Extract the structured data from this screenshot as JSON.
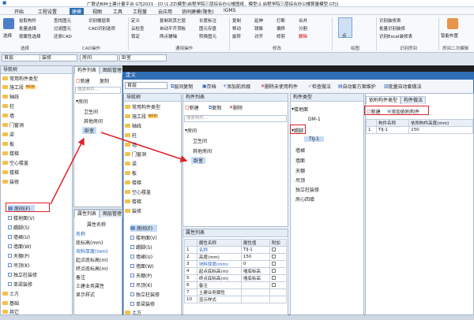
{
  "title": {
    "app": "广联达BIM土建计量平台 GTJ2021 - [D:\\1.ZZ\\模型\\启程学院三层综合办公楼图纸、模型\\1.启程学院三层综合办公楼算量模型.GTJ]",
    "module": "IGMS"
  },
  "menu": [
    "开始",
    "工程设置",
    "建模",
    "视图",
    "工具",
    "工程量",
    "云应用",
    "协同建模(限免)"
  ],
  "ribbon": {
    "select": "选择",
    "pick": "拾取构件",
    "batch": "批量选择",
    "byattr": "按属性选择",
    "findimg": "查找图元",
    "filter": "过滤图元",
    "cad_recog": "识别楼层表",
    "cad_opts": "CAD识别选项",
    "cad_restore": "还原CAD",
    "define": "定义",
    "cloud_check": "云检查",
    "lock": "锁定",
    "copy_to": "复制到其它层",
    "auto_floor": "自动平齐顶板",
    "elem_save": "图元存盘",
    "conv_elem": "转换图元",
    "two_point": "两点辅轴",
    "len_mark": "长度标注",
    "copy": "复制",
    "move": "移动",
    "rotate": "旋转",
    "mirror": "镜像",
    "align": "对齐",
    "extend": "延伸",
    "trim": "修剪",
    "offset": "偏移",
    "break": "打断",
    "merge": "合并",
    "split": "分割",
    "delete": "删除",
    "point": "点",
    "excel_decor": "识别Excel装修表",
    "recog_decor": "识别装修表",
    "batch_recog": "批量识别装修",
    "smart_layout": "智能布置",
    "groups": [
      "选择",
      "CAD操作",
      "通用操作",
      "修改",
      "绘图",
      "识别房间",
      "房间二次编辑"
    ]
  },
  "toolbar_selects": [
    "首层",
    "装修",
    "房间",
    "卧室"
  ],
  "nav": {
    "header": "导航树",
    "items": [
      {
        "label": "常用构件类型",
        "tag": ""
      },
      {
        "label": "施工段",
        "tag": "NEW"
      },
      {
        "label": "轴线",
        "tag": ""
      },
      {
        "label": "柱",
        "tag": ""
      },
      {
        "label": "墙",
        "tag": ""
      },
      {
        "label": "门窗洞",
        "tag": ""
      },
      {
        "label": "梁",
        "tag": ""
      },
      {
        "label": "板",
        "tag": ""
      },
      {
        "label": "楼梯",
        "tag": ""
      },
      {
        "label": "空心楼盖",
        "tag": ""
      },
      {
        "label": "楼梯",
        "tag": ""
      },
      {
        "label": "装修",
        "tag": ""
      }
    ],
    "sub": [
      "房间(F)",
      "楼地面(V)",
      "踢脚(S)",
      "墙裙(U)",
      "墙面(W)",
      "天棚(P)",
      "吊顶(K)",
      "独立柱装修",
      "单梁装修"
    ],
    "tail": [
      "土方",
      "基础",
      "其它",
      "自定义"
    ]
  },
  "left_list": {
    "tabs": [
      "构件列表",
      "图纸管理"
    ],
    "new": "新建",
    "copy": "复制",
    "search": "搜索构件...",
    "root": "房间",
    "items": [
      "卫生间",
      "其他房间",
      "卧室"
    ]
  },
  "left_attr": {
    "tabs": [
      "属性列表",
      "图层管理"
    ],
    "header": "属性名称",
    "rows": [
      "名称",
      "底标高(mm)",
      "块料厚度(mm)",
      "起点底标高(m)",
      "终点底标高(m)",
      "备注",
      "土建业务属性",
      "显示样式"
    ]
  },
  "dialog": {
    "title": "定义",
    "floor": "首层",
    "tools": [
      "层间复制",
      "存档",
      "添加前后缀",
      "删除未使用构件",
      "检查做法",
      "自动套方案维护",
      "批量自动套做法"
    ],
    "nav_header": "导航树",
    "nav_items": [
      "常用构件类型",
      "施工段",
      "轴线",
      "柱",
      "墙",
      "门窗洞",
      "梁",
      "板",
      "楼梯",
      "空心楼盖",
      "楼梯",
      "装修"
    ],
    "nav_new": "NEW",
    "nav_sub": [
      "房间(F)",
      "楼地面(V)",
      "踢脚(S)",
      "墙裙(U)",
      "墙面(W)",
      "天棚(P)",
      "吊顶(K)",
      "独立柱装修",
      "单梁装修"
    ],
    "nav_tail": "土方",
    "list_header": "构件列表",
    "list_new": "新建",
    "list_copy": "复制",
    "list_delete": "删除",
    "list_search": "搜索构件...",
    "list_root": "房间",
    "list_items": [
      "卫生间",
      "其他房间",
      "卧室"
    ],
    "attr_header": "属性列表",
    "attr_cols": [
      "属性名称",
      "属性值",
      "附加"
    ],
    "attr_rows": [
      {
        "n": "1",
        "name": "名称",
        "value": "TIJ-1"
      },
      {
        "n": "2",
        "name": "高度(mm)",
        "value": "150"
      },
      {
        "n": "3",
        "name": "块料厚度(mm)",
        "value": "0"
      },
      {
        "n": "4",
        "name": "起点底标高(m)",
        "value": "墙底标高"
      },
      {
        "n": "5",
        "name": "终点底标高(m)",
        "value": "墙底标高"
      },
      {
        "n": "6",
        "name": "备注",
        "value": ""
      },
      {
        "n": "7",
        "name": "土建业务属性",
        "value": ""
      },
      {
        "n": "10",
        "name": "显示样式",
        "value": ""
      }
    ],
    "types_header": "构件类型",
    "types": [
      {
        "label": "楼地面",
        "depth": 0
      },
      {
        "label": "DM-1",
        "depth": 1
      },
      {
        "label": "踢脚",
        "depth": 0
      },
      {
        "label": "TIJ-1",
        "depth": 1
      },
      {
        "label": "墙裙",
        "depth": 0
      },
      {
        "label": "墙面",
        "depth": 0
      },
      {
        "label": "天棚",
        "depth": 0
      },
      {
        "label": "吊顶",
        "depth": 0
      },
      {
        "label": "独立柱装修",
        "depth": 0
      },
      {
        "label": "房心回填",
        "depth": 0
      }
    ],
    "dep_tabs": [
      "依附构件类型",
      "构件做法"
    ],
    "dep_new": "新建",
    "dep_add": "添加依附构件",
    "dep_cols": [
      "构件名称",
      "依附构件高度(mm)"
    ],
    "dep_rows": [
      {
        "n": "1",
        "name": "TIJ-1",
        "height": "150"
      }
    ]
  },
  "colors": {
    "highlight": "#e0202a",
    "selected": "#c6dcf5",
    "title_blue": "#2f6db5"
  }
}
